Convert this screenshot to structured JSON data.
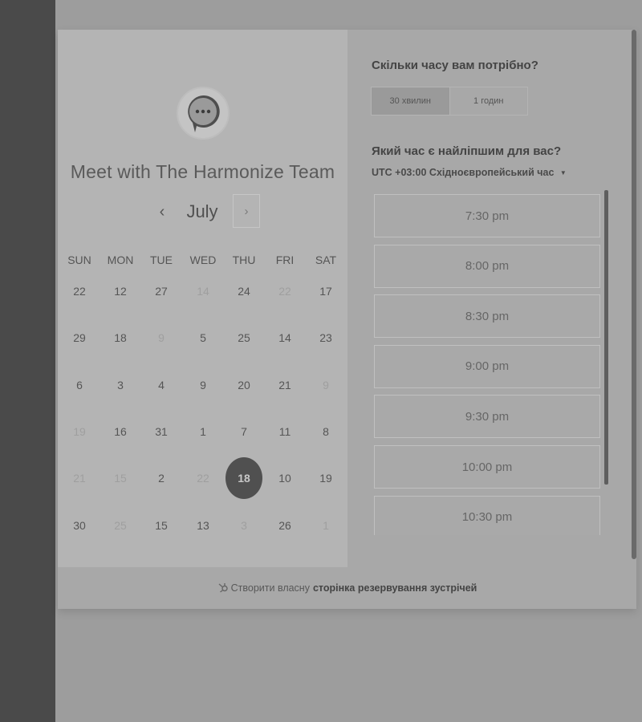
{
  "meeting": {
    "title": "Meet with The Harmonize Team",
    "logo_icon": "chat-bubble-icon"
  },
  "calendar": {
    "month": "July",
    "prev_icon": "‹",
    "next_icon": "›",
    "weekdays": [
      "SUN",
      "MON",
      "TUE",
      "WED",
      "THU",
      "FRI",
      "SAT"
    ],
    "weeks": [
      [
        {
          "d": "22",
          "m": false
        },
        {
          "d": "12",
          "m": false
        },
        {
          "d": "27",
          "m": false
        },
        {
          "d": "14",
          "m": true
        },
        {
          "d": "24",
          "m": false
        },
        {
          "d": "22",
          "m": true
        },
        {
          "d": "17",
          "m": false
        }
      ],
      [
        {
          "d": "29",
          "m": false
        },
        {
          "d": "18",
          "m": false
        },
        {
          "d": "9",
          "m": true
        },
        {
          "d": "5",
          "m": false
        },
        {
          "d": "25",
          "m": false
        },
        {
          "d": "14",
          "m": false
        },
        {
          "d": "23",
          "m": false
        }
      ],
      [
        {
          "d": "6",
          "m": false
        },
        {
          "d": "3",
          "m": false
        },
        {
          "d": "4",
          "m": false
        },
        {
          "d": "9",
          "m": false
        },
        {
          "d": "20",
          "m": false
        },
        {
          "d": "21",
          "m": false
        },
        {
          "d": "9",
          "m": true
        }
      ],
      [
        {
          "d": "19",
          "m": true
        },
        {
          "d": "16",
          "m": false
        },
        {
          "d": "31",
          "m": false
        },
        {
          "d": "1",
          "m": false
        },
        {
          "d": "7",
          "m": false
        },
        {
          "d": "11",
          "m": false
        },
        {
          "d": "8",
          "m": false
        }
      ],
      [
        {
          "d": "21",
          "m": true
        },
        {
          "d": "15",
          "m": true
        },
        {
          "d": "2",
          "m": false
        },
        {
          "d": "22",
          "m": true
        },
        {
          "d": "18",
          "m": false,
          "selected": true
        },
        {
          "d": "10",
          "m": false
        },
        {
          "d": "19",
          "m": false
        }
      ],
      [
        {
          "d": "30",
          "m": false
        },
        {
          "d": "25",
          "m": true
        },
        {
          "d": "15",
          "m": false
        },
        {
          "d": "13",
          "m": false
        },
        {
          "d": "3",
          "m": true
        },
        {
          "d": "26",
          "m": false
        },
        {
          "d": "1",
          "m": true
        }
      ]
    ]
  },
  "duration": {
    "question": "Скільки часу вам потрібно?",
    "options": [
      "30 хвилин",
      "1 годин"
    ],
    "selected_index": 0
  },
  "time": {
    "question": "Який час є найліпшим для вас?",
    "tz_offset": "UTC +03:00",
    "tz_name": "Східноєвропейський час",
    "tz_caret": "▼",
    "slots": [
      "7:30 pm",
      "8:00 pm",
      "8:30 pm",
      "9:00 pm",
      "9:30 pm",
      "10:00 pm",
      "10:30 pm"
    ]
  },
  "footer": {
    "icon": "hubspot-sprocket-icon",
    "text": "Створити власну",
    "link": "сторінка резервування зустрічей"
  }
}
